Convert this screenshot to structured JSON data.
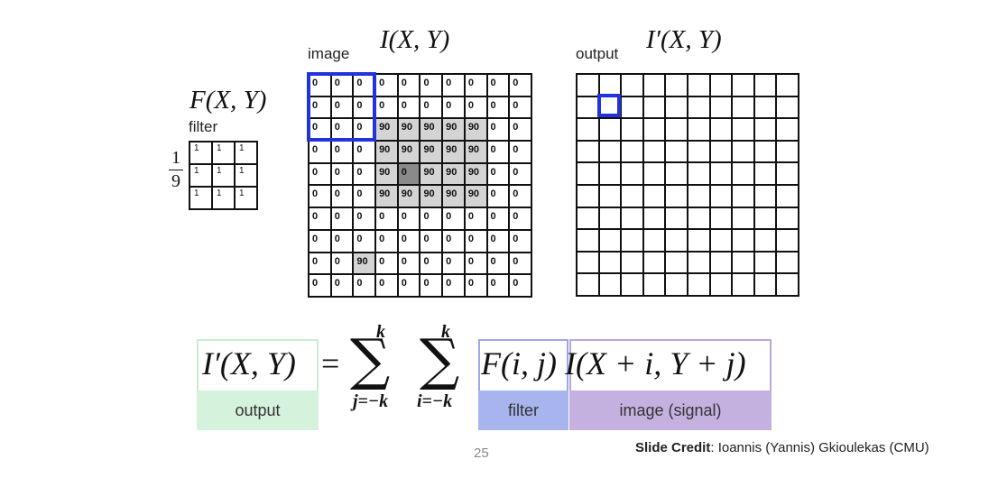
{
  "filter": {
    "title": "F(X, Y)",
    "label": "filter",
    "scale_num": "1",
    "scale_den": "9",
    "cells": [
      "1",
      "1",
      "1",
      "1",
      "1",
      "1",
      "1",
      "1",
      "1"
    ]
  },
  "image": {
    "title": "I(X, Y)",
    "label": "image",
    "rows": [
      [
        "0",
        "0",
        "0",
        "0",
        "0",
        "0",
        "0",
        "0",
        "0",
        "0"
      ],
      [
        "0",
        "0",
        "0",
        "0",
        "0",
        "0",
        "0",
        "0",
        "0",
        "0"
      ],
      [
        "0",
        "0",
        "0",
        "90",
        "90",
        "90",
        "90",
        "90",
        "0",
        "0"
      ],
      [
        "0",
        "0",
        "0",
        "90",
        "90",
        "90",
        "90",
        "90",
        "0",
        "0"
      ],
      [
        "0",
        "0",
        "0",
        "90",
        "0",
        "90",
        "90",
        "90",
        "0",
        "0"
      ],
      [
        "0",
        "0",
        "0",
        "90",
        "90",
        "90",
        "90",
        "90",
        "0",
        "0"
      ],
      [
        "0",
        "0",
        "0",
        "0",
        "0",
        "0",
        "0",
        "0",
        "0",
        "0"
      ],
      [
        "0",
        "0",
        "0",
        "0",
        "0",
        "0",
        "0",
        "0",
        "0",
        "0"
      ],
      [
        "0",
        "0",
        "90",
        "0",
        "0",
        "0",
        "0",
        "0",
        "0",
        "0"
      ],
      [
        "0",
        "0",
        "0",
        "0",
        "0",
        "0",
        "0",
        "0",
        "0",
        "0"
      ]
    ]
  },
  "output": {
    "title": "I′(X, Y)",
    "label": "output"
  },
  "formula": {
    "lhs": "I′(X, Y)",
    "equals": "=",
    "sum_symbol": "∑",
    "upper_limit": "k",
    "lower_j": "j=−k",
    "lower_i": "i=−k",
    "filter_term": "F(i, j)",
    "image_term": "I(X + i, Y + j)",
    "tag_output": "output",
    "tag_filter": "filter",
    "tag_image": "image (signal)",
    "colors": {
      "output": "#d4f2dc",
      "filter": "#a8b4ee",
      "image": "#c4b1e0"
    }
  },
  "footer": {
    "page_number": "25",
    "credit_bold": "Slide Credit",
    "credit_rest": ": Ioannis (Yannis) Gkioulekas (CMU)"
  }
}
